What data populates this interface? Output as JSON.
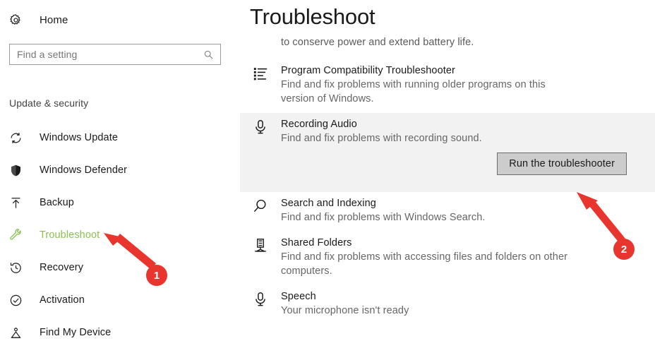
{
  "sidebar": {
    "home": {
      "label": "Home",
      "icon": "gear-icon"
    },
    "search": {
      "placeholder": "Find a setting",
      "value": "",
      "icon": "search-icon"
    },
    "section_title": "Update & security",
    "items": [
      {
        "label": "Windows Update",
        "icon": "refresh-icon",
        "active": false
      },
      {
        "label": "Windows Defender",
        "icon": "shield-icon",
        "active": false
      },
      {
        "label": "Backup",
        "icon": "upload-icon",
        "active": false
      },
      {
        "label": "Troubleshoot",
        "icon": "wrench-icon",
        "active": true
      },
      {
        "label": "Recovery",
        "icon": "history-icon",
        "active": false
      },
      {
        "label": "Activation",
        "icon": "check-circle-icon",
        "active": false
      },
      {
        "label": "Find My Device",
        "icon": "person-pin-icon",
        "active": false
      }
    ],
    "active_color": "#8cc152"
  },
  "main": {
    "title": "Troubleshoot",
    "lead_text": "to conserve power and extend battery life.",
    "troubleshooters": [
      {
        "title": "Program Compatibility Troubleshooter",
        "description": "Find and fix problems with running older programs on this version of Windows.",
        "icon": "list-icon",
        "highlighted": false,
        "button": null
      },
      {
        "title": "Recording Audio",
        "description": "Find and fix problems with recording sound.",
        "icon": "microphone-icon",
        "highlighted": true,
        "button": "Run the troubleshooter"
      },
      {
        "title": "Search and Indexing",
        "description": "Find and fix problems with Windows Search.",
        "icon": "search-icon",
        "highlighted": false,
        "button": null
      },
      {
        "title": "Shared Folders",
        "description": "Find and fix problems with accessing files and folders on other computers.",
        "icon": "server-icon",
        "highlighted": false,
        "button": null
      },
      {
        "title": "Speech",
        "description": "Your microphone isn't ready",
        "icon": "microphone-icon",
        "highlighted": false,
        "button": null
      }
    ]
  },
  "annotations": {
    "color": "#e8362f",
    "steps": [
      {
        "number": "1",
        "target": "Troubleshoot sidebar item"
      },
      {
        "number": "2",
        "target": "Run the troubleshooter button"
      }
    ]
  }
}
